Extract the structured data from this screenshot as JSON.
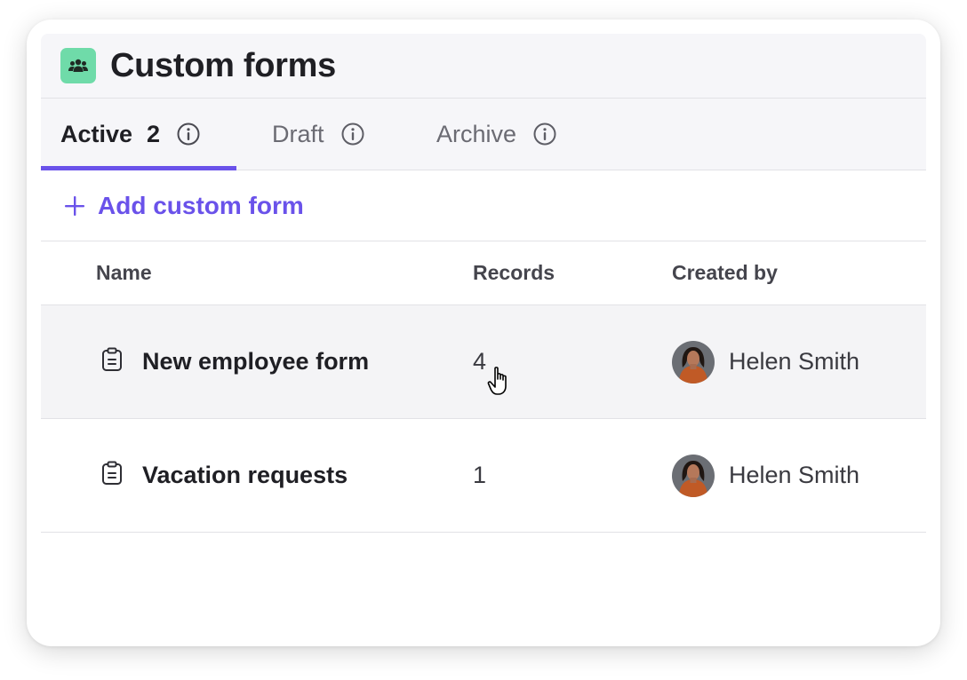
{
  "header": {
    "title": "Custom forms",
    "icon": "people-group-icon",
    "icon_color": "#6fdba9"
  },
  "tabs": [
    {
      "label": "Active",
      "count": "2",
      "active": true,
      "icon": "info-icon"
    },
    {
      "label": "Draft",
      "count": "",
      "active": false,
      "icon": "info-icon"
    },
    {
      "label": "Archive",
      "count": "",
      "active": false,
      "icon": "info-icon"
    }
  ],
  "actions": {
    "add_label": "Add custom form",
    "add_icon": "plus-icon"
  },
  "table": {
    "columns": [
      "Name",
      "Records",
      "Created by"
    ],
    "rows": [
      {
        "name": "New employee form",
        "records": "4",
        "created_by": "Helen Smith",
        "icon": "clipboard-icon"
      },
      {
        "name": "Vacation requests",
        "records": "1",
        "created_by": "Helen Smith",
        "icon": "clipboard-icon"
      }
    ]
  },
  "colors": {
    "accent": "#6a52ea",
    "row_hover": "#f4f4f6"
  }
}
